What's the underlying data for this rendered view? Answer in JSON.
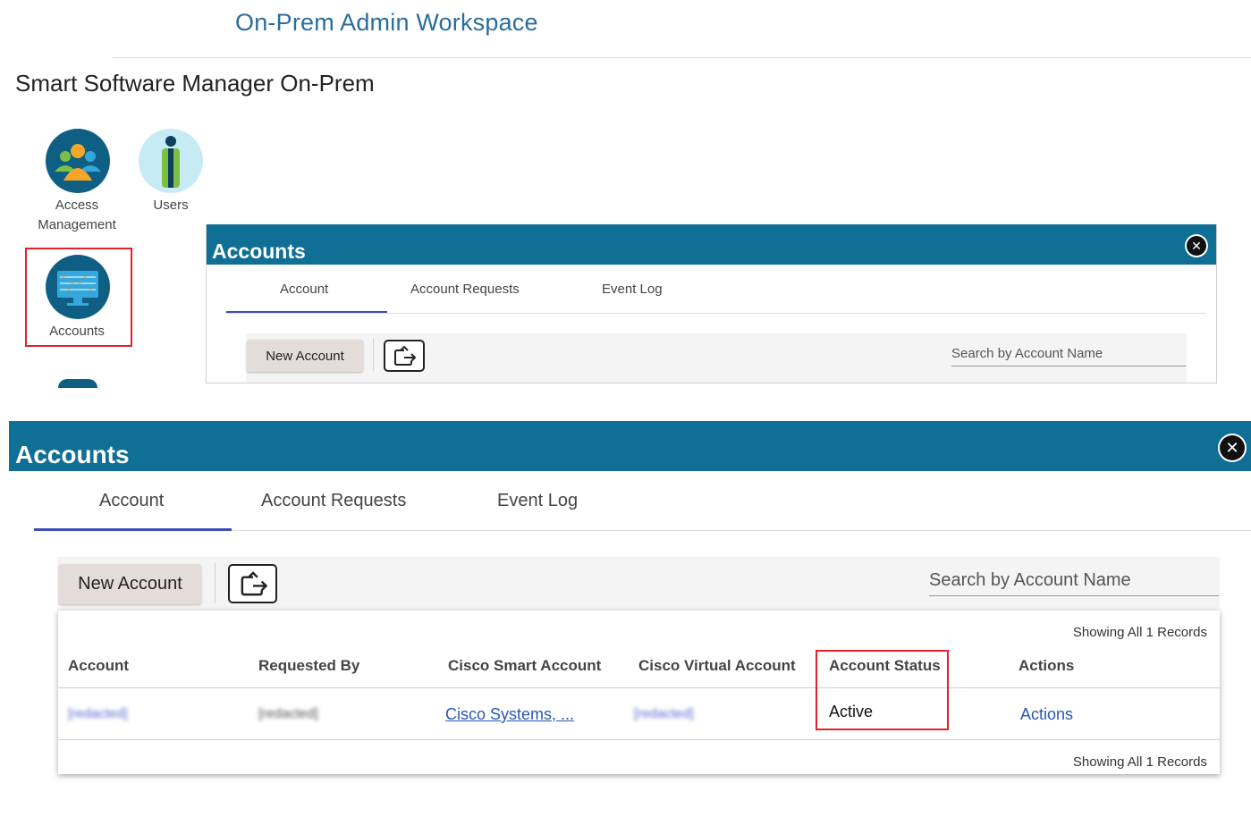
{
  "workspace_title": "On-Prem Admin Workspace",
  "app_title": "Smart Software Manager On-Prem",
  "tiles": [
    {
      "label_line1": "Access",
      "label_line2": "Management"
    },
    {
      "label": "Users"
    },
    {
      "label": "Accounts"
    }
  ],
  "panel": {
    "title": "Accounts",
    "tabs": [
      "Account",
      "Account Requests",
      "Event Log"
    ],
    "active_tab": "Account",
    "new_account_label": "New Account",
    "search_placeholder": "Search by Account Name"
  },
  "table": {
    "records_label": "Showing All 1 Records",
    "columns": [
      "Account",
      "Requested By",
      "Cisco Smart Account",
      "Cisco Virtual Account",
      "Account Status",
      "Actions"
    ],
    "rows": [
      {
        "account": "[redacted]",
        "requested_by": "[redacted]",
        "smart_account": "Cisco Systems, ...",
        "virtual_account": "[redacted]",
        "status": "Active",
        "actions": "Actions"
      }
    ]
  },
  "colors": {
    "header_blue": "#0f6f94",
    "title_blue": "#2a6d9c",
    "tab_underline": "#3b4fb8",
    "highlight_red": "#e3202b",
    "link_blue": "#2a56b8"
  }
}
